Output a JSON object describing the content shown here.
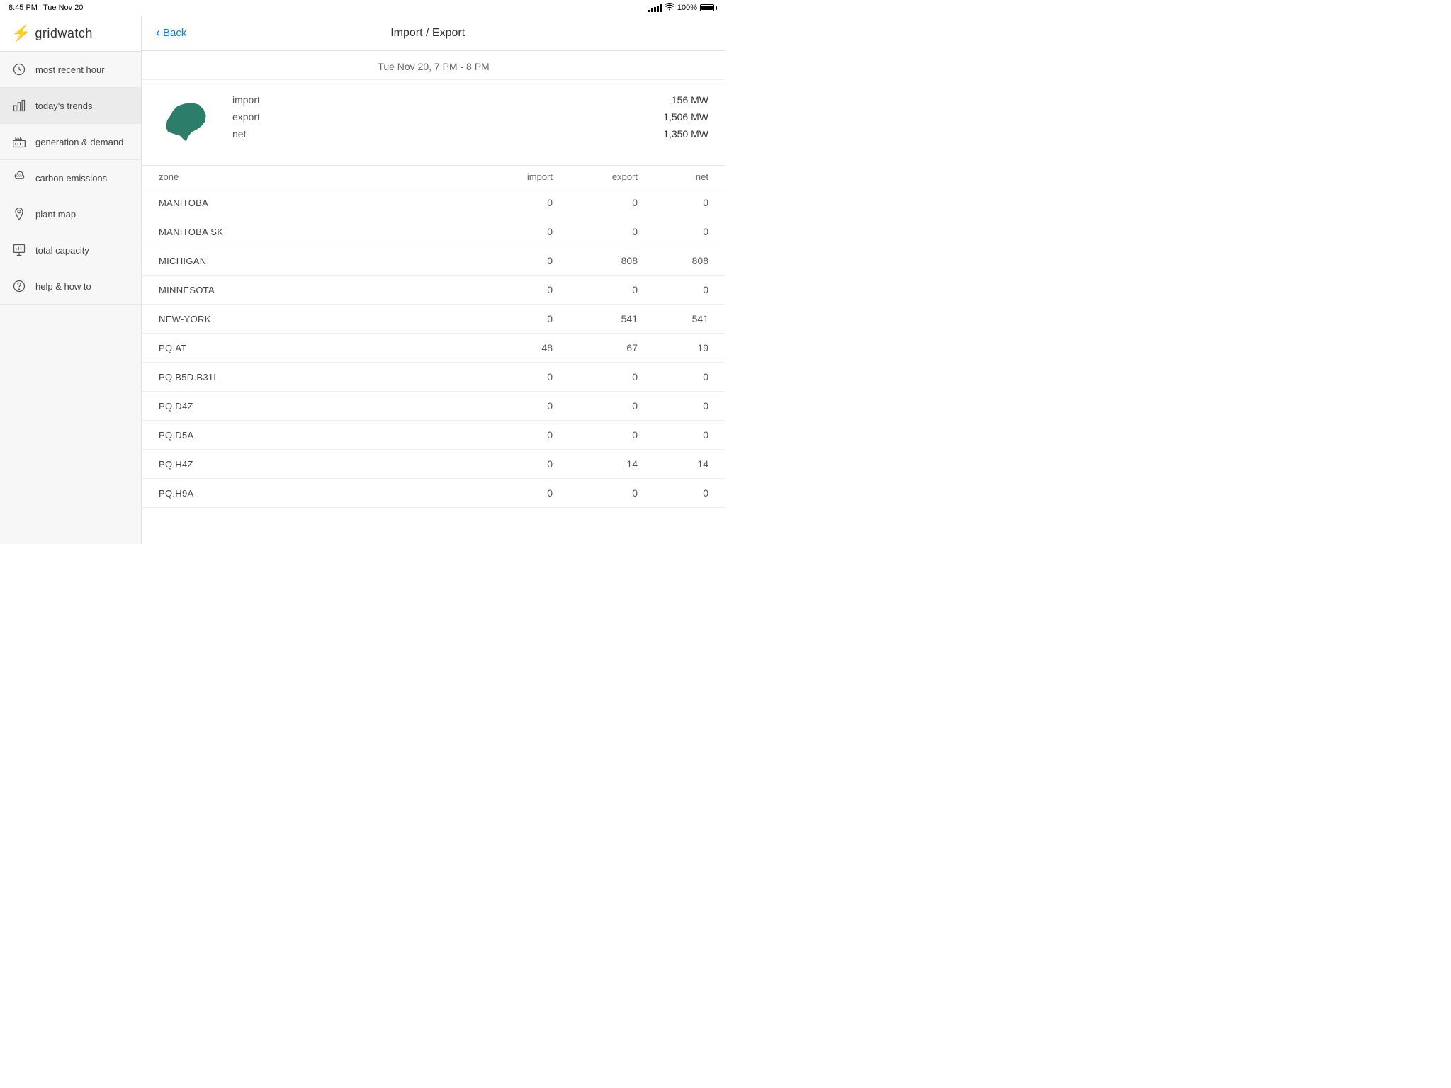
{
  "status_bar": {
    "time": "8:45 PM",
    "date": "Tue Nov 20",
    "battery_pct": "100%"
  },
  "sidebar": {
    "logo_text": "gridwatch",
    "nav_items": [
      {
        "id": "most-recent-hour",
        "label": "most recent hour",
        "icon": "clock"
      },
      {
        "id": "todays-trends",
        "label": "today's trends",
        "icon": "chart-bar",
        "active": true
      },
      {
        "id": "generation-demand",
        "label": "generation & demand",
        "icon": "factory"
      },
      {
        "id": "carbon-emissions",
        "label": "carbon emissions",
        "icon": "cloud"
      },
      {
        "id": "plant-map",
        "label": "plant map",
        "icon": "map-pin"
      },
      {
        "id": "total-capacity",
        "label": "total capacity",
        "icon": "presentation"
      },
      {
        "id": "help-how-to",
        "label": "help & how to",
        "icon": "help-circle"
      }
    ]
  },
  "header": {
    "back_label": "Back",
    "title": "Import / Export"
  },
  "date_subtitle": "Tue Nov 20, 7 PM - 8 PM",
  "summary": {
    "import_label": "import",
    "export_label": "export",
    "net_label": "net",
    "import_value": "156 MW",
    "export_value": "1,506 MW",
    "net_value": "1,350 MW"
  },
  "table": {
    "columns": [
      "zone",
      "import",
      "export",
      "net"
    ],
    "rows": [
      {
        "zone": "MANITOBA",
        "import": "0",
        "export": "0",
        "net": "0"
      },
      {
        "zone": "MANITOBA SK",
        "import": "0",
        "export": "0",
        "net": "0"
      },
      {
        "zone": "MICHIGAN",
        "import": "0",
        "export": "808",
        "net": "808"
      },
      {
        "zone": "MINNESOTA",
        "import": "0",
        "export": "0",
        "net": "0"
      },
      {
        "zone": "NEW-YORK",
        "import": "0",
        "export": "541",
        "net": "541"
      },
      {
        "zone": "PQ.AT",
        "import": "48",
        "export": "67",
        "net": "19"
      },
      {
        "zone": "PQ.B5D.B31L",
        "import": "0",
        "export": "0",
        "net": "0"
      },
      {
        "zone": "PQ.D4Z",
        "import": "0",
        "export": "0",
        "net": "0"
      },
      {
        "zone": "PQ.D5A",
        "import": "0",
        "export": "0",
        "net": "0"
      },
      {
        "zone": "PQ.H4Z",
        "import": "0",
        "export": "14",
        "net": "14"
      },
      {
        "zone": "PQ.H9A",
        "import": "0",
        "export": "0",
        "net": "0"
      }
    ]
  }
}
